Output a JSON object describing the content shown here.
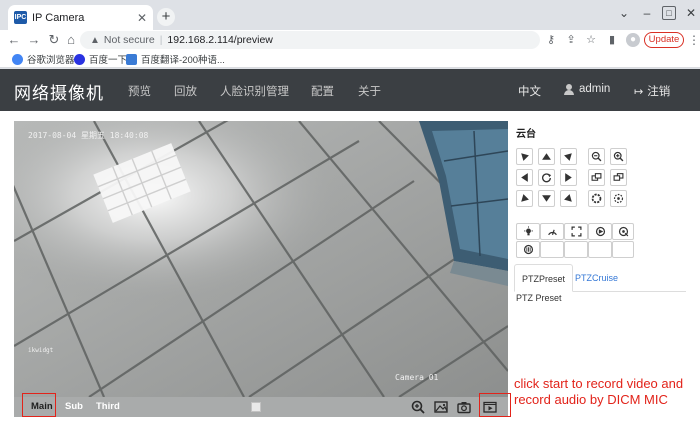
{
  "browser": {
    "tab_title": "IP Camera",
    "tab_favicon": "IPC",
    "url_security": "Not secure",
    "url": "192.168.2.114/preview",
    "update_label": "Update",
    "bookmarks": [
      {
        "label": "谷歌浏览器",
        "color": "#4285f4"
      },
      {
        "label": "百度一下",
        "color": "#2932e1"
      },
      {
        "label": "百度翻译-200种语...",
        "color": "#3a7bd5"
      }
    ]
  },
  "app": {
    "brand": "网络摄像机",
    "nav": [
      "预览",
      "回放",
      "人脸识别管理",
      "配置",
      "关于"
    ],
    "language": "中文",
    "user": "admin",
    "logout": "注销"
  },
  "video": {
    "timestamp": "2017-08-04 星期五 18:40:08",
    "camera_label": "Camera 01",
    "watermark": "ikwidgt",
    "streams": [
      "Main",
      "Sub",
      "Third"
    ],
    "active_stream": "Main"
  },
  "ptz": {
    "title": "云台",
    "tabs": [
      "PTZPreset",
      "PTZCruise"
    ],
    "preset_label": "PTZ Preset"
  },
  "annotation": "click start to record video and record audio by DICM MIC",
  "colors": {
    "header_bg": "#3b3f43",
    "highlight": "#e2231a",
    "tab_link": "#3578d6"
  }
}
